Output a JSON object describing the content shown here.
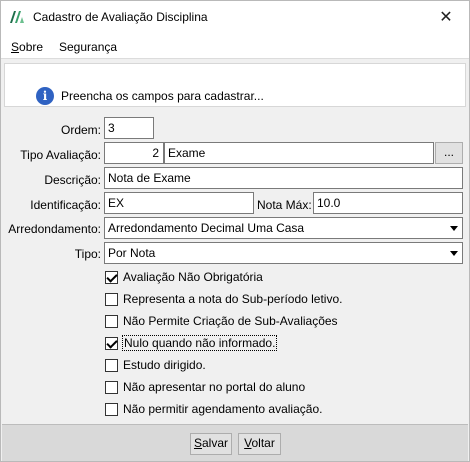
{
  "window": {
    "title": "Cadastro de Avaliação Disciplina",
    "close_glyph": "✕"
  },
  "menu": {
    "items": [
      {
        "accel": "S",
        "rest": "obre"
      },
      {
        "accel": "",
        "rest": "Segurança"
      }
    ]
  },
  "info": {
    "icon": "info-icon",
    "message": "Preencha os campos para cadastrar..."
  },
  "form": {
    "ordem": {
      "label": "Ordem:",
      "value": "3"
    },
    "tipo_avaliacao": {
      "label": "Tipo Avaliação:",
      "code": "2",
      "name": "Exame",
      "lookup_label": "..."
    },
    "descricao": {
      "label": "Descrição:",
      "value": "Nota de Exame"
    },
    "identificacao": {
      "label": "Identificação:",
      "value": "EX"
    },
    "nota_max": {
      "label": "Nota Máx:",
      "value": "10.0"
    },
    "arredondamento": {
      "label": "Arredondamento:",
      "value": "Arredondamento Decimal Uma Casa"
    },
    "tipo": {
      "label": "Tipo:",
      "value": "Por Nota"
    }
  },
  "options": [
    {
      "label": "Avaliação Não Obrigatória",
      "checked": true
    },
    {
      "label": "Representa a nota do Sub-período letivo.",
      "checked": false
    },
    {
      "label": "Não Permite Criação de Sub-Avaliações",
      "checked": false
    },
    {
      "label": "Nulo quando não informado.",
      "checked": true
    },
    {
      "label": "Estudo dirigido.",
      "checked": false
    },
    {
      "label": "Não apresentar no portal do aluno",
      "checked": false
    },
    {
      "label": "Não permitir agendamento avaliação.",
      "checked": false
    }
  ],
  "footer": {
    "save": {
      "accel": "S",
      "rest": "alvar"
    },
    "back": {
      "accel": "V",
      "rest": "oltar"
    }
  }
}
